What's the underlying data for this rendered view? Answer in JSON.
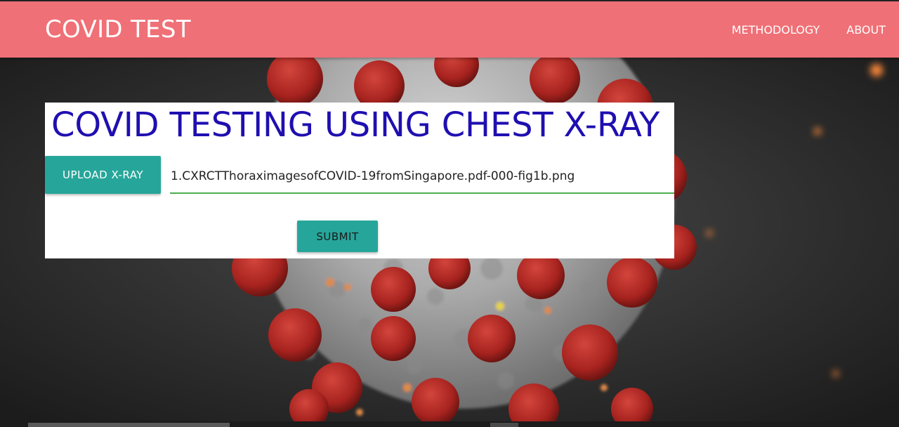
{
  "navbar": {
    "brand": "COVID TEST",
    "links": [
      {
        "label": "METHODOLOGY"
      },
      {
        "label": "ABOUT"
      }
    ],
    "background_color": "#ef7076"
  },
  "card": {
    "title": "COVID TESTING USING CHEST X-RAY",
    "upload_label": "UPLOAD X-RAY",
    "file_path_value": "1.CXRCTThoraximagesofCOVID-19fromSingapore.pdf-000-fig1b.png",
    "submit_label": "SUBMIT",
    "title_color": "#1f0fb0",
    "button_color": "#26a69a",
    "underline_color": "#4caf50"
  },
  "background": {
    "image": "coronavirus-illustration"
  }
}
